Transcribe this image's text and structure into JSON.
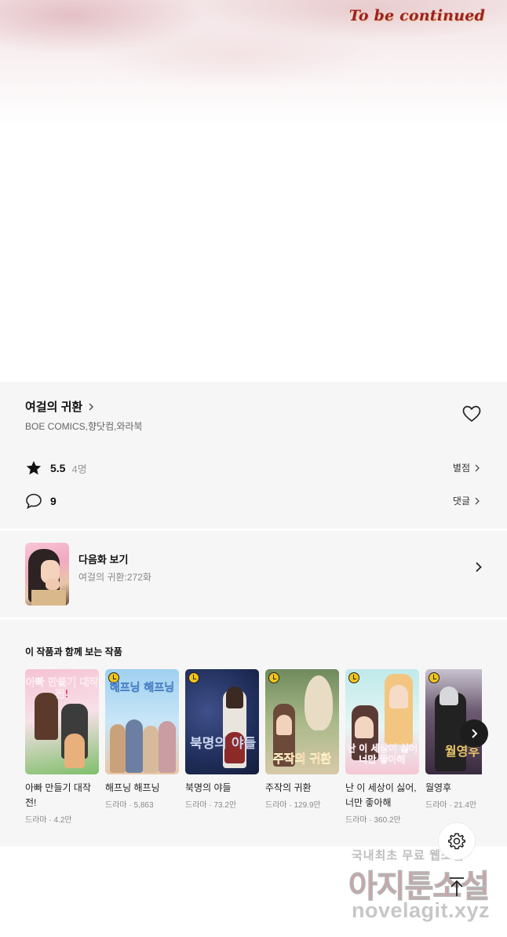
{
  "viewer": {
    "end_banner": "To be continued"
  },
  "series": {
    "title": "여걸의 귀환",
    "authors": "BOE COMICS,향닷컴,와라북"
  },
  "rating": {
    "score": "5.5",
    "count": "4명",
    "link_label": "별점"
  },
  "comments": {
    "count": "9",
    "link_label": "댓글"
  },
  "next_episode": {
    "label": "다음화 보기",
    "subtitle": "여걸의 귀환:272화"
  },
  "recommendations": {
    "title": "이 작품과 함께 보는 작품",
    "items": [
      {
        "name": "아빠 만들기 대작전!",
        "meta": "드라마 · 4.2만",
        "cover_text": "아빠 만들기 대작전!",
        "colors": [
          "#f6c3d3",
          "#7fbf6a"
        ]
      },
      {
        "name": "해프닝 해프닝",
        "meta": "드라마 · 5,863",
        "cover_text": "해프닝 해프닝",
        "colors": [
          "#9fd0f0",
          "#e8c9a8"
        ]
      },
      {
        "name": "북명의 야들",
        "meta": "드라마 · 73.2만",
        "cover_text": "북명의 야들",
        "colors": [
          "#1f2e5a",
          "#c9d4ee"
        ]
      },
      {
        "name": "주작의 귀환",
        "meta": "드라마 · 129.9만",
        "cover_text": "주작의 귀환",
        "colors": [
          "#6f8a5c",
          "#d7c9a9"
        ]
      },
      {
        "name": "난 이 세상이 싫어, 너만 좋아해",
        "meta": "드라마 · 360.2만",
        "cover_text": "난 이 세상이 싫어 너만 좋아해",
        "colors": [
          "#bfe9ea",
          "#f6c7d5"
        ]
      },
      {
        "name": "월영후",
        "meta": "드라마 · 21.4만",
        "cover_text": "월영후",
        "colors": [
          "#3a2b3f",
          "#c9c3cf"
        ]
      }
    ]
  },
  "watermark": {
    "line1": "국내최초 무료 웹소설",
    "line2": "아지툰소설",
    "line3": "novelagit.xyz"
  },
  "icons": {
    "heart": "heart-icon",
    "star": "star-icon",
    "comment": "comment-icon",
    "settings": "gear-icon",
    "scroll_top": "arrow-up-icon"
  }
}
